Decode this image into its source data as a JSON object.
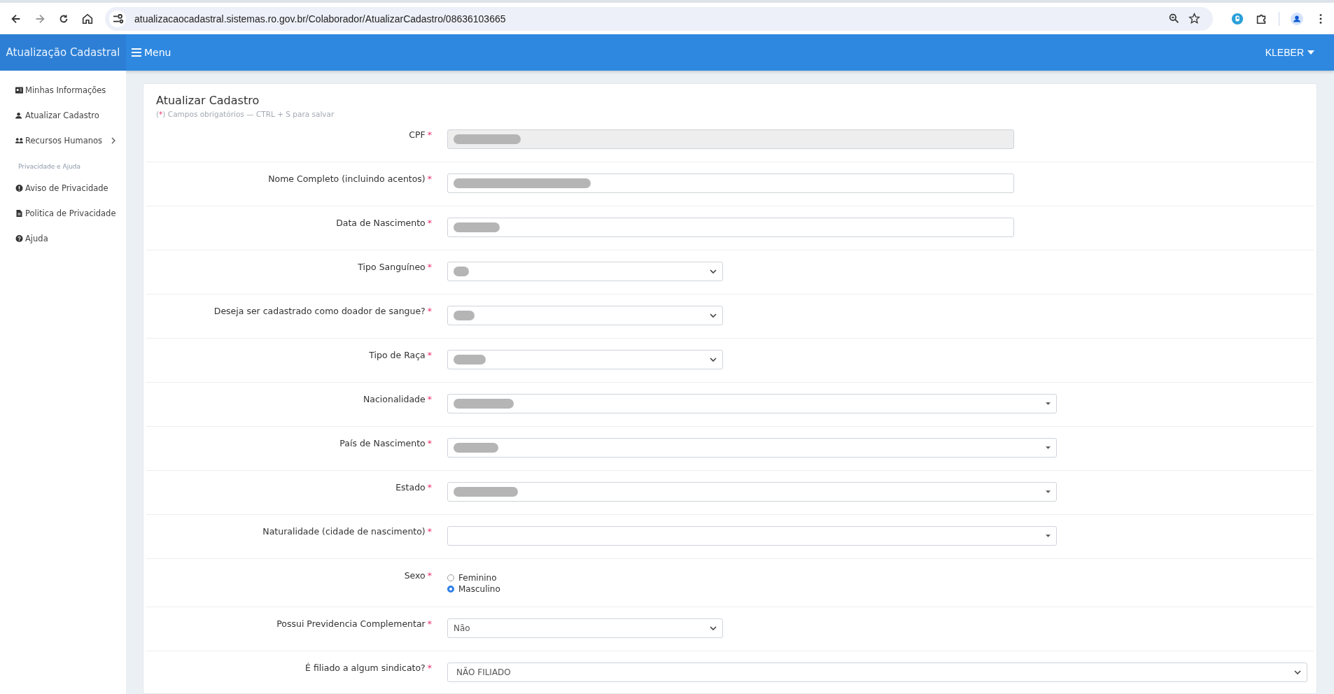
{
  "browser": {
    "url": "atualizacaocadastral.sistemas.ro.gov.br/Colaborador/AtualizarCadastro/08636103665"
  },
  "header": {
    "brand": "Atualização Cadastral",
    "menu": "Menu",
    "user": "KLEBER"
  },
  "sidebar": {
    "items": [
      {
        "label": "Minhas Informações",
        "kind": "id-card",
        "submenu": false
      },
      {
        "label": "Atualizar Cadastro",
        "kind": "user",
        "submenu": false
      },
      {
        "label": "Recursos Humanos",
        "kind": "users",
        "submenu": true
      }
    ],
    "section": "Privacidade e Ajuda",
    "help_items": [
      {
        "label": "Aviso de Privacidade",
        "kind": "alert"
      },
      {
        "label": "Politica de Privacidade",
        "kind": "file"
      },
      {
        "label": "Ajuda",
        "kind": "question"
      }
    ]
  },
  "form": {
    "title": "Atualizar Cadastro",
    "required_mark": "*",
    "hint_open": "(",
    "hint_close": ")",
    "hint": "Campos obrigatórios — CTRL + S para salvar",
    "fields": [
      {
        "label": "CPF",
        "kind": "text",
        "disabled": true,
        "redacted": true
      },
      {
        "label": "Nome Completo (incluindo acentos)",
        "kind": "text",
        "disabled": false,
        "redacted": true
      },
      {
        "label": "Data de Nascimento",
        "kind": "text",
        "disabled": false,
        "redacted": true
      },
      {
        "label": "Tipo Sanguíneo",
        "kind": "select",
        "redacted": true
      },
      {
        "label": "Deseja ser cadastrado como doador de sangue?",
        "kind": "select",
        "redacted": true
      },
      {
        "label": "Tipo de Raça",
        "kind": "select",
        "redacted": true
      },
      {
        "label": "Nacionalidade",
        "kind": "combo",
        "redacted": true
      },
      {
        "label": "País de Nascimento",
        "kind": "combo",
        "redacted": true
      },
      {
        "label": "Estado",
        "kind": "combo",
        "redacted": true
      },
      {
        "label": "Naturalidade (cidade de nascimento)",
        "kind": "combo",
        "redacted": false
      },
      {
        "label": "Sexo",
        "kind": "radio",
        "options": [
          {
            "label": "Feminino",
            "selected": false
          },
          {
            "label": "Masculino",
            "selected": true
          }
        ]
      },
      {
        "label": "Possui Previdencia Complementar",
        "kind": "select",
        "redacted": false,
        "value": "Não"
      },
      {
        "label": "É filiado a algum sindicato?",
        "kind": "select-wide",
        "redacted": false,
        "value": "NÃO FILIADO"
      }
    ]
  }
}
